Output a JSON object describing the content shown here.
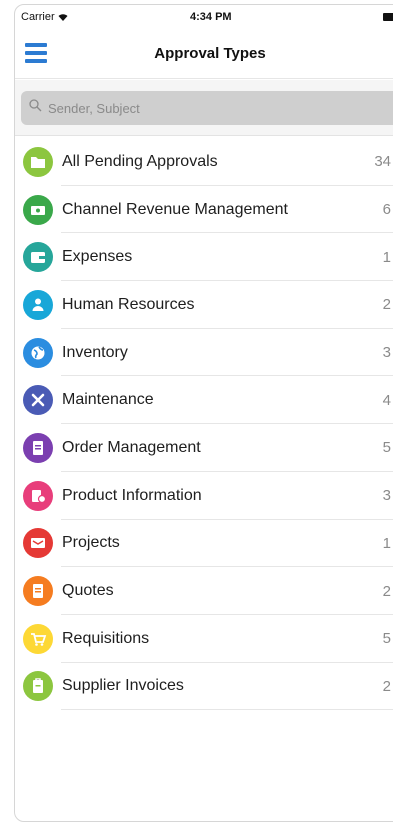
{
  "status": {
    "carrier": "Carrier",
    "time": "4:34 PM"
  },
  "nav": {
    "title": "Approval Types",
    "menu_icon": "hamburger-menu-icon"
  },
  "search": {
    "placeholder": "Sender, Subject",
    "value": "",
    "icon": "search-icon"
  },
  "items": [
    {
      "label": "All Pending Approvals",
      "count": "34",
      "color": "#8cc63f",
      "icon": "folder-icon"
    },
    {
      "label": "Channel Revenue Management",
      "count": "6",
      "color": "#3aa84a",
      "icon": "money-icon"
    },
    {
      "label": "Expenses",
      "count": "1",
      "color": "#26a69a",
      "icon": "wallet-icon"
    },
    {
      "label": "Human Resources",
      "count": "2",
      "color": "#18a7d8",
      "icon": "person-icon"
    },
    {
      "label": "Inventory",
      "count": "3",
      "color": "#2b8de0",
      "icon": "globe-icon"
    },
    {
      "label": "Maintenance",
      "count": "4",
      "color": "#4a5bb5",
      "icon": "tools-icon"
    },
    {
      "label": "Order Management",
      "count": "5",
      "color": "#7b3fb0",
      "icon": "document-icon"
    },
    {
      "label": "Product Information",
      "count": "3",
      "color": "#e83e7b",
      "icon": "product-info-icon"
    },
    {
      "label": "Projects",
      "count": "1",
      "color": "#e53935",
      "icon": "projects-icon"
    },
    {
      "label": "Quotes",
      "count": "2",
      "color": "#f57c20",
      "icon": "quotes-icon"
    },
    {
      "label": "Requisitions",
      "count": "5",
      "color": "#fdd835",
      "icon": "cart-icon"
    },
    {
      "label": "Supplier Invoices",
      "count": "2",
      "color": "#8cc63f",
      "icon": "invoice-icon"
    }
  ]
}
